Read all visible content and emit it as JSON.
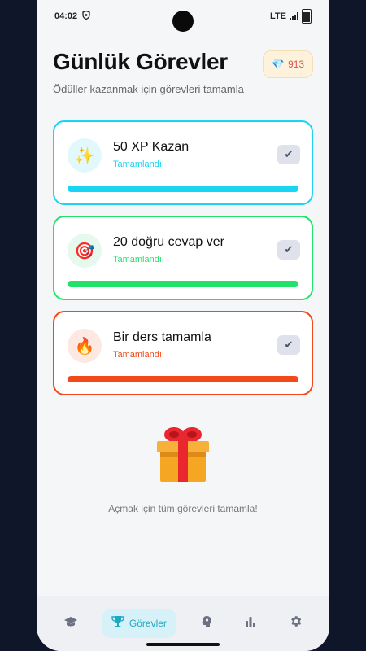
{
  "status_bar": {
    "time": "04:02",
    "network": "LTE"
  },
  "header": {
    "title": "Günlük Görevler",
    "subtitle": "Ödüller kazanmak için görevleri tamamla"
  },
  "gems": {
    "icon": "gem-icon",
    "count": "913"
  },
  "quests": [
    {
      "icon": "sparkles-icon",
      "icon_glyph": "✨",
      "title": "50 XP Kazan",
      "status": "Tamamlandı!",
      "progress": 1.0,
      "accent": "#19d4f2",
      "icon_bg": "#e3f8fc"
    },
    {
      "icon": "target-icon",
      "icon_glyph": "🎯",
      "title": "20 doğru cevap ver",
      "status": "Tamamlandı!",
      "progress": 1.0,
      "accent": "#21e36c",
      "icon_bg": "#e5f9ec"
    },
    {
      "icon": "fire-icon",
      "icon_glyph": "🔥",
      "title": "Bir ders tamamla",
      "status": "Tamamlandı!",
      "progress": 1.0,
      "accent": "#f2481a",
      "icon_bg": "#fde8e2"
    }
  ],
  "reward": {
    "icon": "gift-icon",
    "text": "Açmak için tüm görevleri tamamla!"
  },
  "nav": {
    "items": [
      {
        "name": "graduation-cap-icon",
        "glyph": "🎓",
        "label": "",
        "active": false
      },
      {
        "name": "trophy-icon",
        "glyph": "🏆",
        "label": "Görevler",
        "active": true
      },
      {
        "name": "brain-icon",
        "glyph": "🧠",
        "label": "",
        "active": false
      },
      {
        "name": "bar-chart-icon",
        "glyph": "▮",
        "label": "",
        "active": false
      },
      {
        "name": "gear-icon",
        "glyph": "⚙",
        "label": "",
        "active": false
      }
    ]
  }
}
